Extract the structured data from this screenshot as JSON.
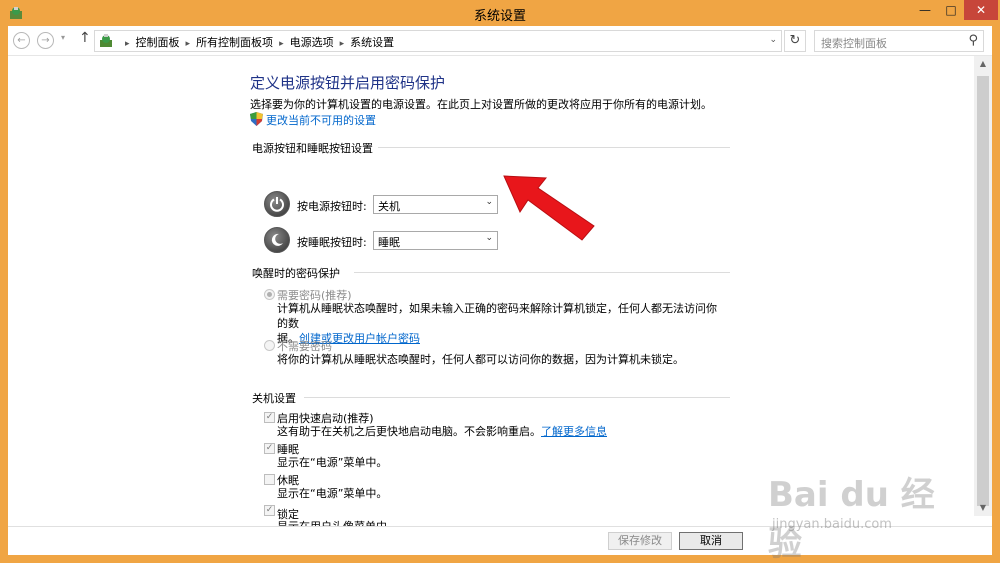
{
  "window": {
    "title": "系统设置",
    "minimize": "—",
    "maximize": "□",
    "close": "✕"
  },
  "nav": {
    "back": "←",
    "forward": "→",
    "dropdown": "▾",
    "up": "↑",
    "breadcrumbs": [
      "控制面板",
      "所有控制面板项",
      "电源选项",
      "系统设置"
    ],
    "separator": "▸",
    "address_dropdown": "⌄",
    "refresh": "↻",
    "search_placeholder": "搜索控制面板",
    "search_icon": "⚲"
  },
  "page": {
    "title": "定义电源按钮并启用密码保护",
    "description": "选择要为你的计算机设置的电源设置。在此页上对设置所做的更改将应用于你所有的电源计划。",
    "change_settings_link": "更改当前不可用的设置"
  },
  "buttons_section": {
    "heading": "电源按钮和睡眠按钮设置",
    "power_label": "按电源按钮时:",
    "power_value": "关机",
    "sleep_label": "按睡眠按钮时:",
    "sleep_value": "睡眠"
  },
  "password_section": {
    "heading": "唤醒时的密码保护",
    "require_title": "需要密码(推荐)",
    "require_desc": "计算机从睡眠状态唤醒时，如果未输入正确的密码来解除计算机锁定，任何人都无法访问你的数",
    "require_desc_line2": "据。",
    "require_link": "创建或更改用户帐户密码",
    "norequire_title": "不需要密码",
    "norequire_desc": "将你的计算机从睡眠状态唤醒时，任何人都可以访问你的数据，因为计算机未锁定。"
  },
  "shutdown_section": {
    "heading": "关机设置",
    "items": [
      {
        "label": "启用快速启动(推荐)",
        "desc": "这有助于在关机之后更快地启动电脑。不会影响重启。",
        "link": "了解更多信息",
        "checked": true
      },
      {
        "label": "睡眠",
        "desc": "显示在“电源”菜单中。",
        "checked": true
      },
      {
        "label": "休眠",
        "desc": "显示在“电源”菜单中。",
        "checked": false
      },
      {
        "label": "锁定",
        "desc": "显示在用户头像菜单中。",
        "checked": true
      }
    ]
  },
  "footer": {
    "save": "保存修改",
    "cancel": "取消"
  },
  "watermark": {
    "logo": "Bai du 经验",
    "url": "jingyan.baidu.com"
  },
  "colors": {
    "accent_orange": "#f0a544",
    "title_blue": "#1e3287",
    "link_blue": "#0066cc",
    "close_red": "#c7463a",
    "arrow_red": "#e8161b"
  }
}
